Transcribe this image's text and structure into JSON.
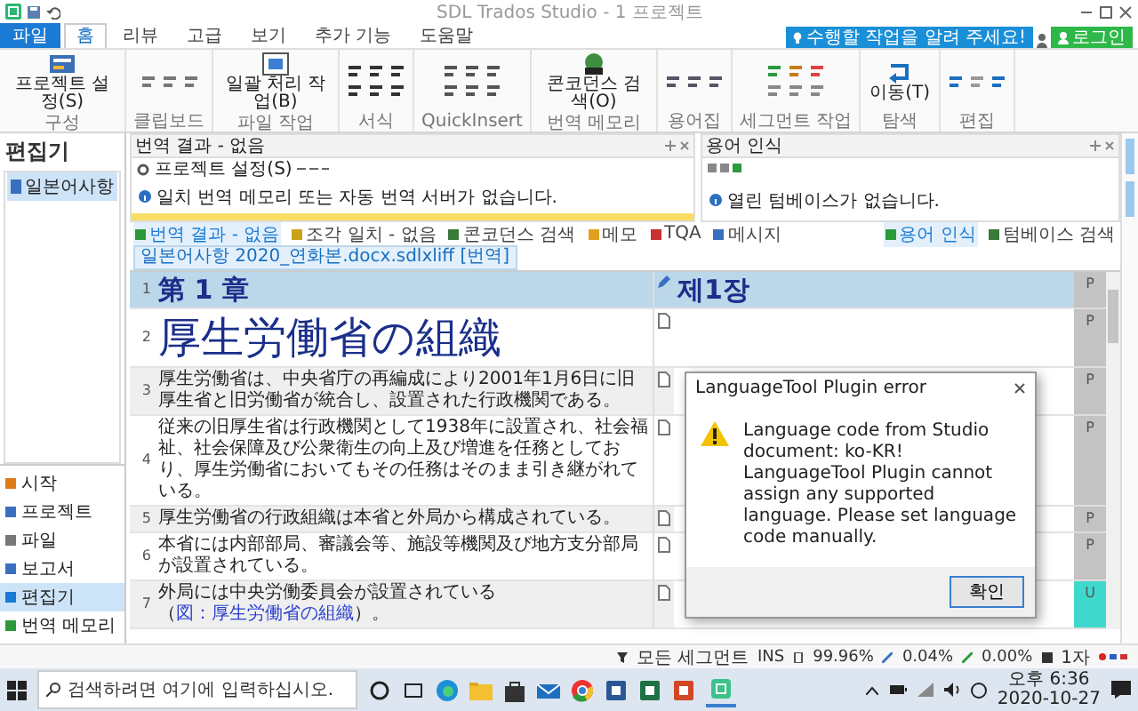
{
  "window": {
    "title": "SDL Trados Studio - 1 프로젝트"
  },
  "ribbon": {
    "tabs": [
      {
        "label": "파일",
        "kind": "file",
        "selected": false
      },
      {
        "label": "홈",
        "kind": "tab",
        "selected": true
      },
      {
        "label": "리뷰",
        "kind": "tab",
        "selected": false
      },
      {
        "label": "고급",
        "kind": "tab",
        "selected": false
      },
      {
        "label": "보기",
        "kind": "tab",
        "selected": false
      },
      {
        "label": "추가 기능",
        "kind": "tab",
        "selected": false
      },
      {
        "label": "도움말",
        "kind": "tab",
        "selected": false
      }
    ],
    "help": "수행할 작업을 알려 주세요!",
    "login": "로그인",
    "groups": [
      {
        "label": "구성",
        "kind": "large",
        "button": "프로젝트 설정(S)"
      },
      {
        "label": "클립보드",
        "kind": "small"
      },
      {
        "label": "파일 작업",
        "kind": "large",
        "button": "일괄 처리 작업(B)"
      },
      {
        "label": "서식",
        "kind": "small"
      },
      {
        "label": "QuickInsert",
        "kind": "small"
      },
      {
        "label": "번역 메모리",
        "kind": "large",
        "button": "콘코던스 검색(O)"
      },
      {
        "label": "용어집",
        "kind": "small"
      },
      {
        "label": "세그먼트 작업",
        "kind": "small"
      },
      {
        "label": "탐색",
        "kind": "large",
        "button": "이동(T)"
      },
      {
        "label": "편집",
        "kind": "small"
      }
    ]
  },
  "nav": {
    "header": "편집기",
    "tree": [
      {
        "label": "일본어사항",
        "selected": true
      }
    ],
    "items": [
      {
        "label": "시작",
        "selected": false
      },
      {
        "label": "프로젝트",
        "selected": false
      },
      {
        "label": "파일",
        "selected": false
      },
      {
        "label": "보고서",
        "selected": false
      },
      {
        "label": "편집기",
        "selected": true
      },
      {
        "label": "번역 메모리",
        "selected": false
      }
    ]
  },
  "results": {
    "title": "번역 결과 - 없음",
    "toolbar": "프로젝트 설정(S)",
    "message": "일치 번역 메모리 또는 자동 번역 서버가 없습니다."
  },
  "terms": {
    "title": "용어 인식",
    "message": "열린 텀베이스가 없습니다."
  },
  "panel_tabs": [
    {
      "label": "번역 결과 - 없음",
      "selected": true
    },
    {
      "label": "조각 일치 - 없음",
      "selected": false
    },
    {
      "label": "콘코던스 검색",
      "selected": false
    },
    {
      "label": "메모",
      "selected": false
    },
    {
      "label": "TQA",
      "selected": false
    },
    {
      "label": "메시지",
      "selected": false
    }
  ],
  "term_tabs": [
    {
      "label": "용어 인식",
      "selected": true
    },
    {
      "label": "텀베이스 검색",
      "selected": false
    }
  ],
  "document_tab": "일본어사항 2020_연화본.docx.sdlxliff [번역]",
  "segments": [
    {
      "kind": "heading",
      "number": "1",
      "source": "第 1 章",
      "target": "제1장",
      "translated": true,
      "status": "P"
    },
    {
      "kind": "title",
      "number": "2",
      "source": "厚生労働省の組織",
      "translated": false,
      "status": "P"
    },
    {
      "kind": "text",
      "number": "3",
      "source": "厚生労働省は、中央省庁の再編成により2001年1月6日に旧厚生省と旧労働省が統合し、設置された行政機関である。",
      "translated": false,
      "status": "P"
    },
    {
      "kind": "text",
      "number": "4",
      "source": "従来の旧厚生省は行政機関として1938年に設置され、社会福祉、社会保障及び公衆衛生の向上及び増進を任務としており、厚生労働省においてもその任務はそのまま引き継がれている。",
      "translated": false,
      "status": "P"
    },
    {
      "kind": "text",
      "number": "5",
      "source": "厚生労働省の行政組織は本省と外局から構成されている。",
      "translated": false,
      "status": "P"
    },
    {
      "kind": "text",
      "number": "6",
      "source": "本省には内部部局、審議会等、施設等機関及び地方支分部局が設置されている。",
      "translated": false,
      "status": "P"
    },
    {
      "kind": "link",
      "number": "7",
      "source": "外局には中央労働委員会が設置されている（",
      "link": "図：厚生労働省の組織",
      "after": "）。",
      "translated": false,
      "status": "U"
    }
  ],
  "dialog": {
    "title": "LanguageTool Plugin error",
    "message": "Language code from Studio document: ko-KR! LanguageTool Plugin cannot assign any supported language. Please set language code manually.",
    "button": "확인"
  },
  "status_bar": [
    "모든 세그먼트",
    "INS",
    "99.96%",
    "0.04%",
    "0.00%",
    "1자"
  ],
  "taskbar": {
    "search": {
      "placeholder": "검색하려면 여기에 입력하십시오."
    },
    "time": "오후 6:36",
    "date": "2020-10-27"
  }
}
